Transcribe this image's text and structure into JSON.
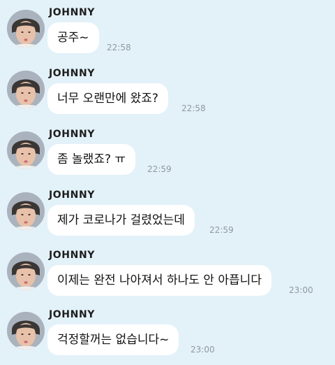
{
  "chat": {
    "messages": [
      {
        "sender": "JOHNNY",
        "text": "공주~",
        "time": "22:58",
        "avatar_icon": "profile-photo-icon"
      },
      {
        "sender": "JOHNNY",
        "text": "너무 오랜만에 왔죠?",
        "time": "22:58",
        "avatar_icon": "profile-photo-icon"
      },
      {
        "sender": "JOHNNY",
        "text": "좀 놀랬죠? ㅠ",
        "time": "22:59",
        "avatar_icon": "profile-photo-icon"
      },
      {
        "sender": "JOHNNY",
        "text": "제가 코로나가 걸렸었는데",
        "time": "22:59",
        "avatar_icon": "profile-photo-icon"
      },
      {
        "sender": "JOHNNY",
        "text": "이제는 완전 나아져서 하나도 안 아픕니다",
        "time": "23:00",
        "avatar_icon": "profile-photo-icon"
      },
      {
        "sender": "JOHNNY",
        "text": "걱정할꺼는 없습니다~",
        "time": "23:00",
        "avatar_icon": "profile-photo-icon"
      }
    ]
  },
  "colors": {
    "background": "#e3f1f9",
    "bubble": "#ffffff",
    "timestamp": "#8f9aa3"
  }
}
